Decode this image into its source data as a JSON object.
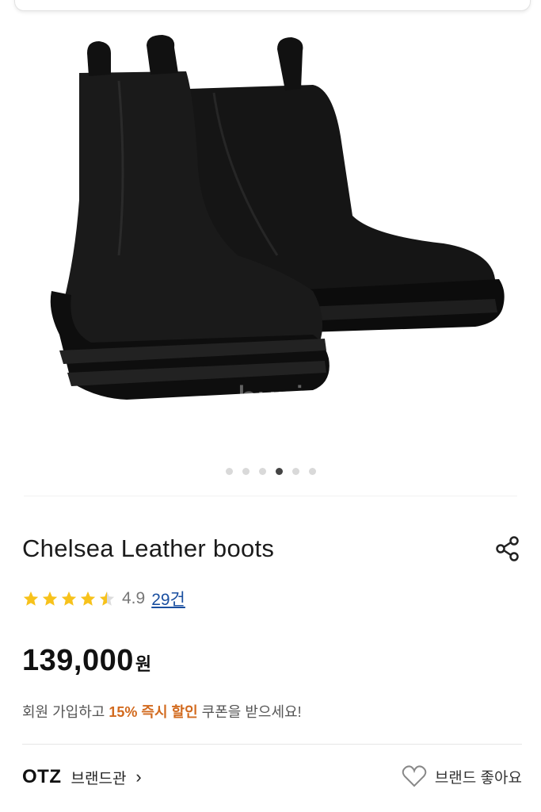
{
  "gallery": {
    "watermark": "bunjang",
    "dot_count": 6,
    "active_index": 3
  },
  "product": {
    "title": "Chelsea Leather boots",
    "rating": {
      "score": "4.9",
      "stars": 4.5,
      "reviews": "29건"
    },
    "price": {
      "amount": "139,000",
      "currency": "원"
    },
    "promo": {
      "before": "회원 가입하고 ",
      "highlight": "15% 즉시 할인",
      "after": " 쿠폰을 받으세요!"
    }
  },
  "brand": {
    "name": "OTZ",
    "link_label": "브랜드관",
    "chevron": "›",
    "like_label": "브랜드 좋아요"
  },
  "colors": {
    "star": "#f7c21b",
    "accent": "#d26a1e",
    "link": "#1a4fa0"
  }
}
